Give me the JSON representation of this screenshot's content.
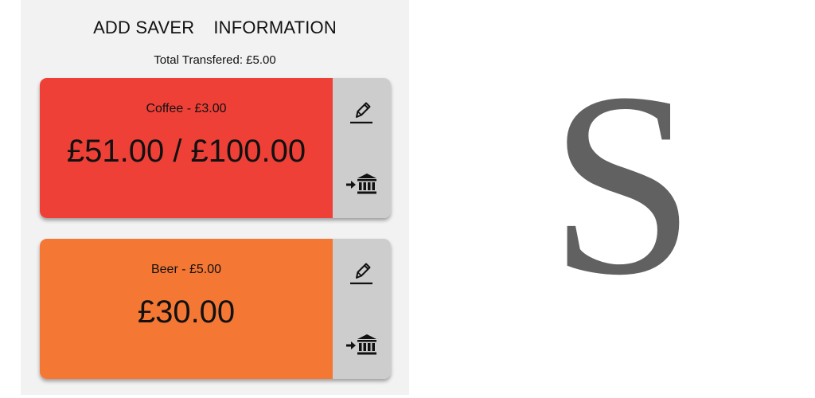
{
  "nav": {
    "add_saver": "ADD SAVER",
    "information": "INFORMATION"
  },
  "total_transferred": "Total Transfered: £5.00",
  "savers": [
    {
      "title": "Coffee - £3.00",
      "amount": "£51.00 / £100.00",
      "color": "#ee4037",
      "edit_icon": "pencil-icon",
      "transfer_icon": "bank-transfer-icon"
    },
    {
      "title": "Beer - £5.00",
      "amount": "£30.00",
      "color": "#f47734",
      "edit_icon": "pencil-icon",
      "transfer_icon": "bank-transfer-icon"
    }
  ],
  "logo": {
    "letter": "S",
    "color": "#616161"
  }
}
